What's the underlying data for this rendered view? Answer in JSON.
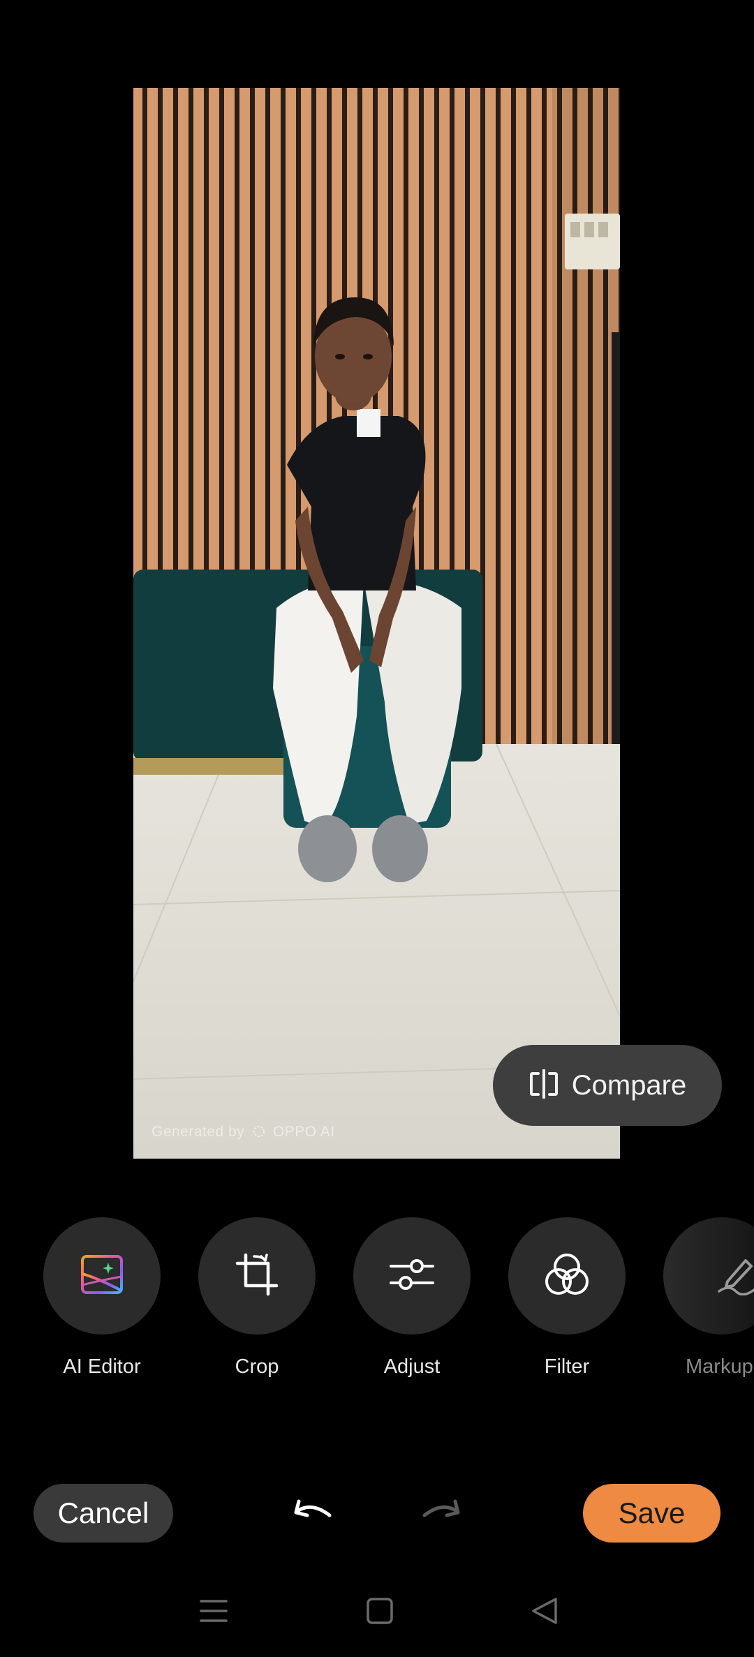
{
  "photo": {
    "watermark_prefix": "Generated by",
    "watermark_brand": "OPPO AI"
  },
  "compare": {
    "label": "Compare",
    "icon": "compare-split-icon"
  },
  "tools": [
    {
      "label": "AI Editor",
      "icon": "ai-editor-icon"
    },
    {
      "label": "Crop",
      "icon": "crop-icon"
    },
    {
      "label": "Adjust",
      "icon": "sliders-icon"
    },
    {
      "label": "Filter",
      "icon": "filter-circles-icon"
    },
    {
      "label": "Markup",
      "icon": "pen-icon"
    }
  ],
  "actions": {
    "cancel_label": "Cancel",
    "save_label": "Save",
    "undo_icon": "undo-icon",
    "redo_icon": "redo-icon"
  },
  "colors": {
    "accent": "#ee8a42",
    "button_bg": "#3a3a3a",
    "tool_bg": "#2b2b2b"
  },
  "navbar": {
    "icons": [
      "menu-icon",
      "home-square-icon",
      "back-triangle-icon"
    ]
  }
}
